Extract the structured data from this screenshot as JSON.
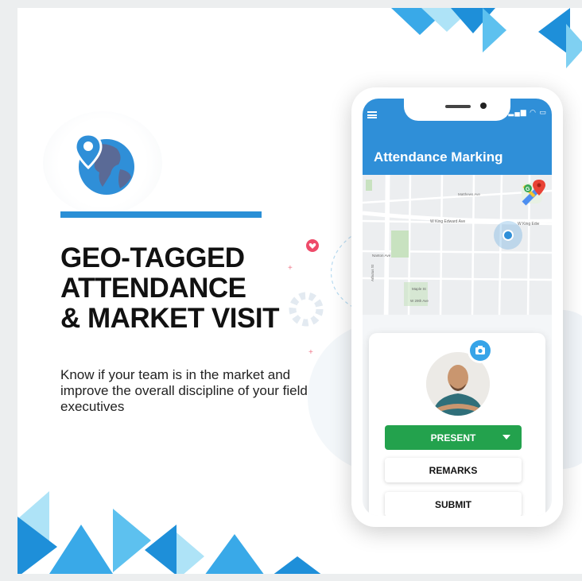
{
  "headline": {
    "line1": "GEO-TAGGED",
    "line2": "ATTENDANCE",
    "line3": "& MARKET VISIT"
  },
  "description": "Know if your team is in the market and improve the overall discipline of your field executives",
  "phone": {
    "app_title": "Attendance Marking",
    "status_icons": "▂▄▆ ◠ ▭",
    "map": {
      "streets": [
        "W King Edward Ave",
        "W King Edw",
        "Matthews Ave",
        "Arbutus St",
        "Nanton Ave",
        "W 29th Ave",
        "Maple St"
      ]
    },
    "status_select": {
      "value": "PRESENT"
    },
    "remarks_button": "REMARKS",
    "submit_button": "SUBMIT"
  },
  "colors": {
    "accent_blue": "#2a8fd6",
    "app_bar": "#2f8fd8",
    "present_green": "#23a24d",
    "triangle_light": "#aee3f7",
    "triangle_dark": "#1e8fd9"
  },
  "icons": [
    "globe-pin-icon",
    "menu-icon",
    "google-maps-icon",
    "location-dot-icon",
    "camera-icon",
    "chevron-down-icon",
    "heart-badge-icon",
    "gear-icon"
  ]
}
